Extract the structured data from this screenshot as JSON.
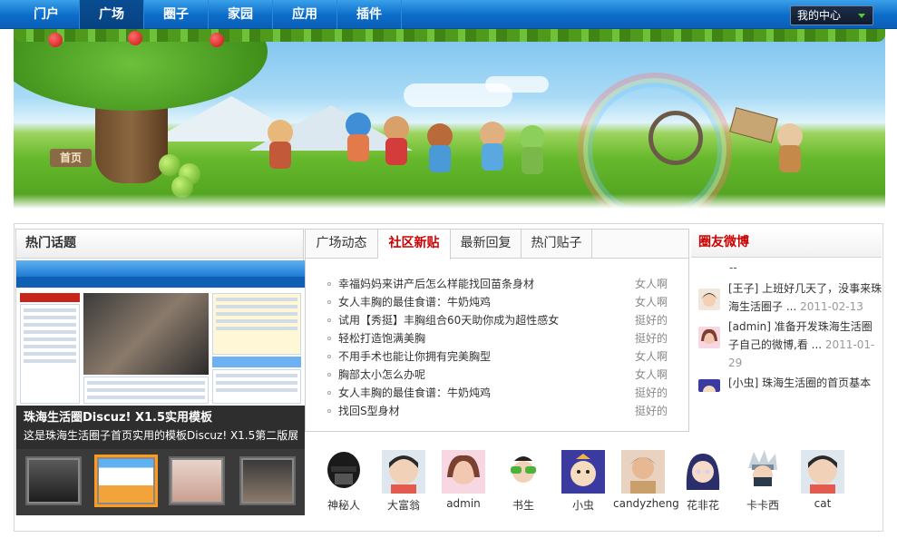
{
  "nav": {
    "items": [
      {
        "label": "门户",
        "active": false
      },
      {
        "label": "广场",
        "active": true
      },
      {
        "label": "圈子",
        "active": false
      },
      {
        "label": "家园",
        "active": false
      },
      {
        "label": "应用",
        "active": false
      },
      {
        "label": "插件",
        "active": false
      }
    ],
    "user_center": "我的中心"
  },
  "banner": {
    "home_sign": "首页"
  },
  "hot_topics": {
    "title": "热门话题",
    "caption_title": "珠海生活圈Discuz! X1.5实用模板",
    "caption_desc": "这是珠海生活圈子首页实用的模板Discuz! X1.5第二版展"
  },
  "center": {
    "tabs": [
      {
        "label": "广场动态",
        "active": false
      },
      {
        "label": "社区新贴",
        "active": true
      },
      {
        "label": "最新回复",
        "active": false
      },
      {
        "label": "热门贴子",
        "active": false
      }
    ],
    "posts": [
      {
        "title": "幸福妈妈来讲产后怎么样能找回苗条身材",
        "author": "女人啊"
      },
      {
        "title": "女人丰胸的最佳食谱：牛奶炖鸡",
        "author": "女人啊"
      },
      {
        "title": "试用【秀挺】丰胸组合60天助你成为超性感女",
        "author": "挺好的"
      },
      {
        "title": "轻松打造饱满美胸",
        "author": "挺好的"
      },
      {
        "title": "不用手术也能让你拥有完美胸型",
        "author": "女人啊"
      },
      {
        "title": "胸部太小怎么办呢",
        "author": "女人啊"
      },
      {
        "title": "女人丰胸的最佳食谱：牛奶炖鸡",
        "author": "挺好的"
      },
      {
        "title": "找回S型身材",
        "author": "挺好的"
      }
    ]
  },
  "members": [
    {
      "name": "神秘人",
      "color": "#1a1a1a"
    },
    {
      "name": "大富翁",
      "color": "#e35b4f"
    },
    {
      "name": "admin",
      "color": "#f2b7c8"
    },
    {
      "name": "书生",
      "color": "#4bb33a"
    },
    {
      "name": "小虫",
      "color": "#3a3aa0"
    },
    {
      "name": "candyzheng",
      "color": "#e9d2bf"
    },
    {
      "name": "花非花",
      "color": "#2a2f6b"
    },
    {
      "name": "卡卡西",
      "color": "#8a9aa8"
    },
    {
      "name": "cat",
      "color": "#e35b4f"
    }
  ],
  "weibo": {
    "title": "圈友微博",
    "dash": "--",
    "items": [
      {
        "text": "[王子] 上班好几天了，没事来珠海生活圈子 ...",
        "date": "2011-02-13"
      },
      {
        "text": "[admin] 准备开发珠海生活圈子自己的微博,看 ...",
        "date": "2011-01-29"
      },
      {
        "text": "[小虫] 珠海生活圈的首页基本",
        "date": ""
      }
    ]
  }
}
